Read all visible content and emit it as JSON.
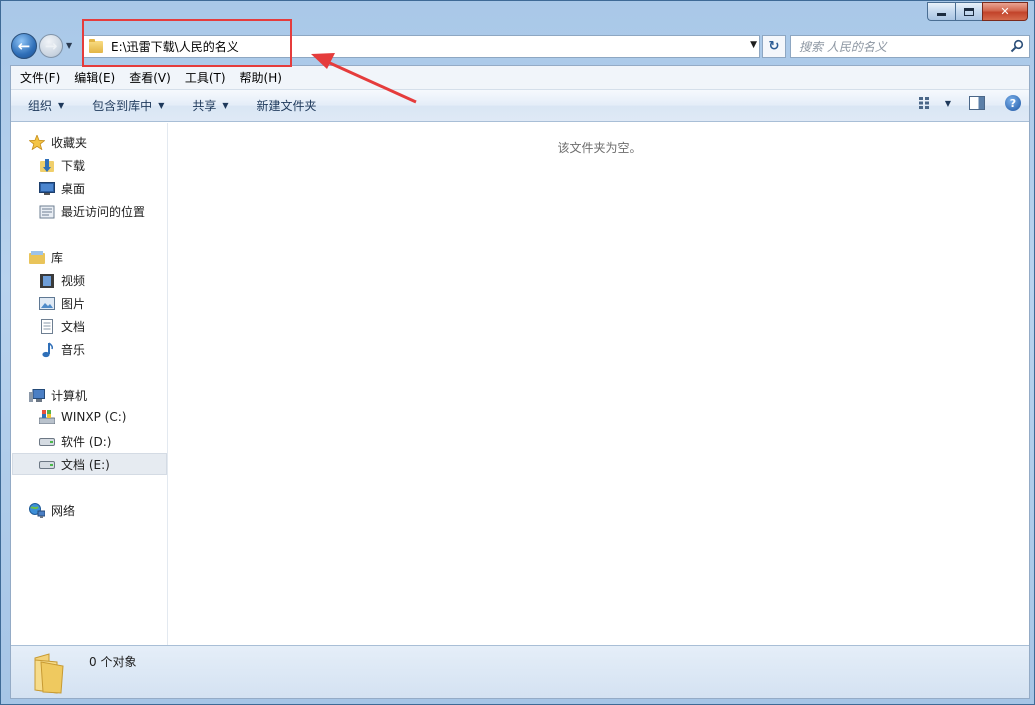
{
  "window": {
    "address_path": "E:\\迅雷下载\\人民的名义",
    "search_placeholder": "搜索 人民的名义",
    "refresh_label": "↻"
  },
  "menu": [
    "文件(F)",
    "编辑(E)",
    "查看(V)",
    "工具(T)",
    "帮助(H)"
  ],
  "commands": {
    "organize": "组织",
    "include_in_library": "包含到库中",
    "share": "共享",
    "new_folder": "新建文件夹"
  },
  "nav": {
    "favorites": {
      "label": "收藏夹",
      "items": [
        "下载",
        "桌面",
        "最近访问的位置"
      ]
    },
    "libraries": {
      "label": "库",
      "items": [
        "视频",
        "图片",
        "文档",
        "音乐"
      ]
    },
    "computer": {
      "label": "计算机",
      "items": [
        "WINXP (C:)",
        "软件 (D:)",
        "文档 (E:)"
      ],
      "selected": "文档 (E:)"
    },
    "network": {
      "label": "网络"
    }
  },
  "content": {
    "empty_message": "该文件夹为空。"
  },
  "status": {
    "object_count": "0 个对象"
  },
  "colors": {
    "annotation": "#e53c3c",
    "accent": "#2f6fb8"
  }
}
